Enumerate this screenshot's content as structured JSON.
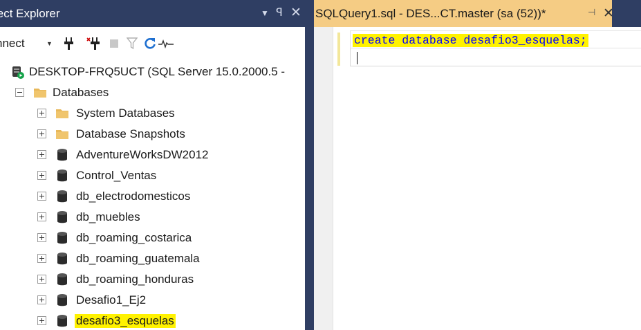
{
  "object_explorer": {
    "title": "ject Explorer",
    "toolbar": {
      "connect_label": "nnect"
    },
    "tree": {
      "server": "DESKTOP-FRQ5UCT (SQL Server 15.0.2000.5 -",
      "databases_folder": "Databases",
      "items": [
        {
          "label": "System Databases",
          "kind": "folder"
        },
        {
          "label": "Database Snapshots",
          "kind": "folder"
        },
        {
          "label": "AdventureWorksDW2012",
          "kind": "database"
        },
        {
          "label": "Control_Ventas",
          "kind": "database"
        },
        {
          "label": "db_electrodomesticos",
          "kind": "database"
        },
        {
          "label": "db_muebles",
          "kind": "database"
        },
        {
          "label": "db_roaming_costarica",
          "kind": "database"
        },
        {
          "label": "db_roaming_guatemala",
          "kind": "database"
        },
        {
          "label": "db_roaming_honduras",
          "kind": "database"
        },
        {
          "label": "Desafio1_Ej2",
          "kind": "database"
        },
        {
          "label": "desafio3_esquelas",
          "kind": "database",
          "highlighted": true
        }
      ]
    }
  },
  "editor": {
    "tab_title": "SQLQuery1.sql - DES...CT.master (sa (52))*",
    "code_line_1": "create database desafio3_esquelas;",
    "code_line_2": ""
  },
  "colors": {
    "title_bar": "#2f3e63",
    "active_tab": "#f5cc84",
    "highlight": "#fff200",
    "keyword": "#0000ff"
  }
}
